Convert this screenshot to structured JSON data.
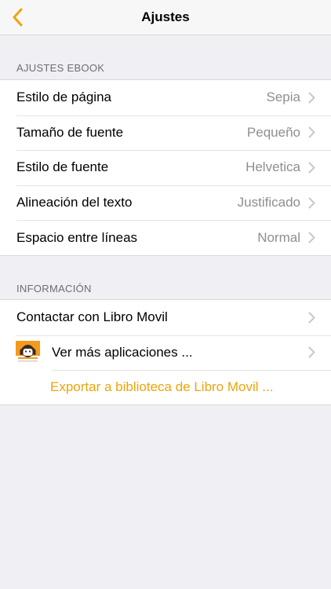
{
  "navbar": {
    "title": "Ajustes",
    "back_icon": "chevron-left-icon",
    "accent_color": "#f0a30a"
  },
  "ebook_section": {
    "header": "AJUSTES EBOOK",
    "rows": [
      {
        "label": "Estilo de página",
        "value": "Sepia"
      },
      {
        "label": "Tamaño de fuente",
        "value": "Pequeño"
      },
      {
        "label": "Estilo de fuente",
        "value": "Helvetica"
      },
      {
        "label": "Alineación del texto",
        "value": "Justificado"
      },
      {
        "label": "Espacio entre líneas",
        "value": "Normal"
      }
    ]
  },
  "info_section": {
    "header": "INFORMACIÓN",
    "contact_label": "Contactar con Libro Movil",
    "more_apps_label": "Ver más aplicaciones ...",
    "more_apps_icon": "libro-movil-app-icon",
    "export_label": "Exportar a biblioteca de Libro Movil ..."
  },
  "colors": {
    "background": "#efeff4",
    "secondary_text": "#8e8e93",
    "section_header": "#6d6d72",
    "accent": "#f0a30a"
  }
}
